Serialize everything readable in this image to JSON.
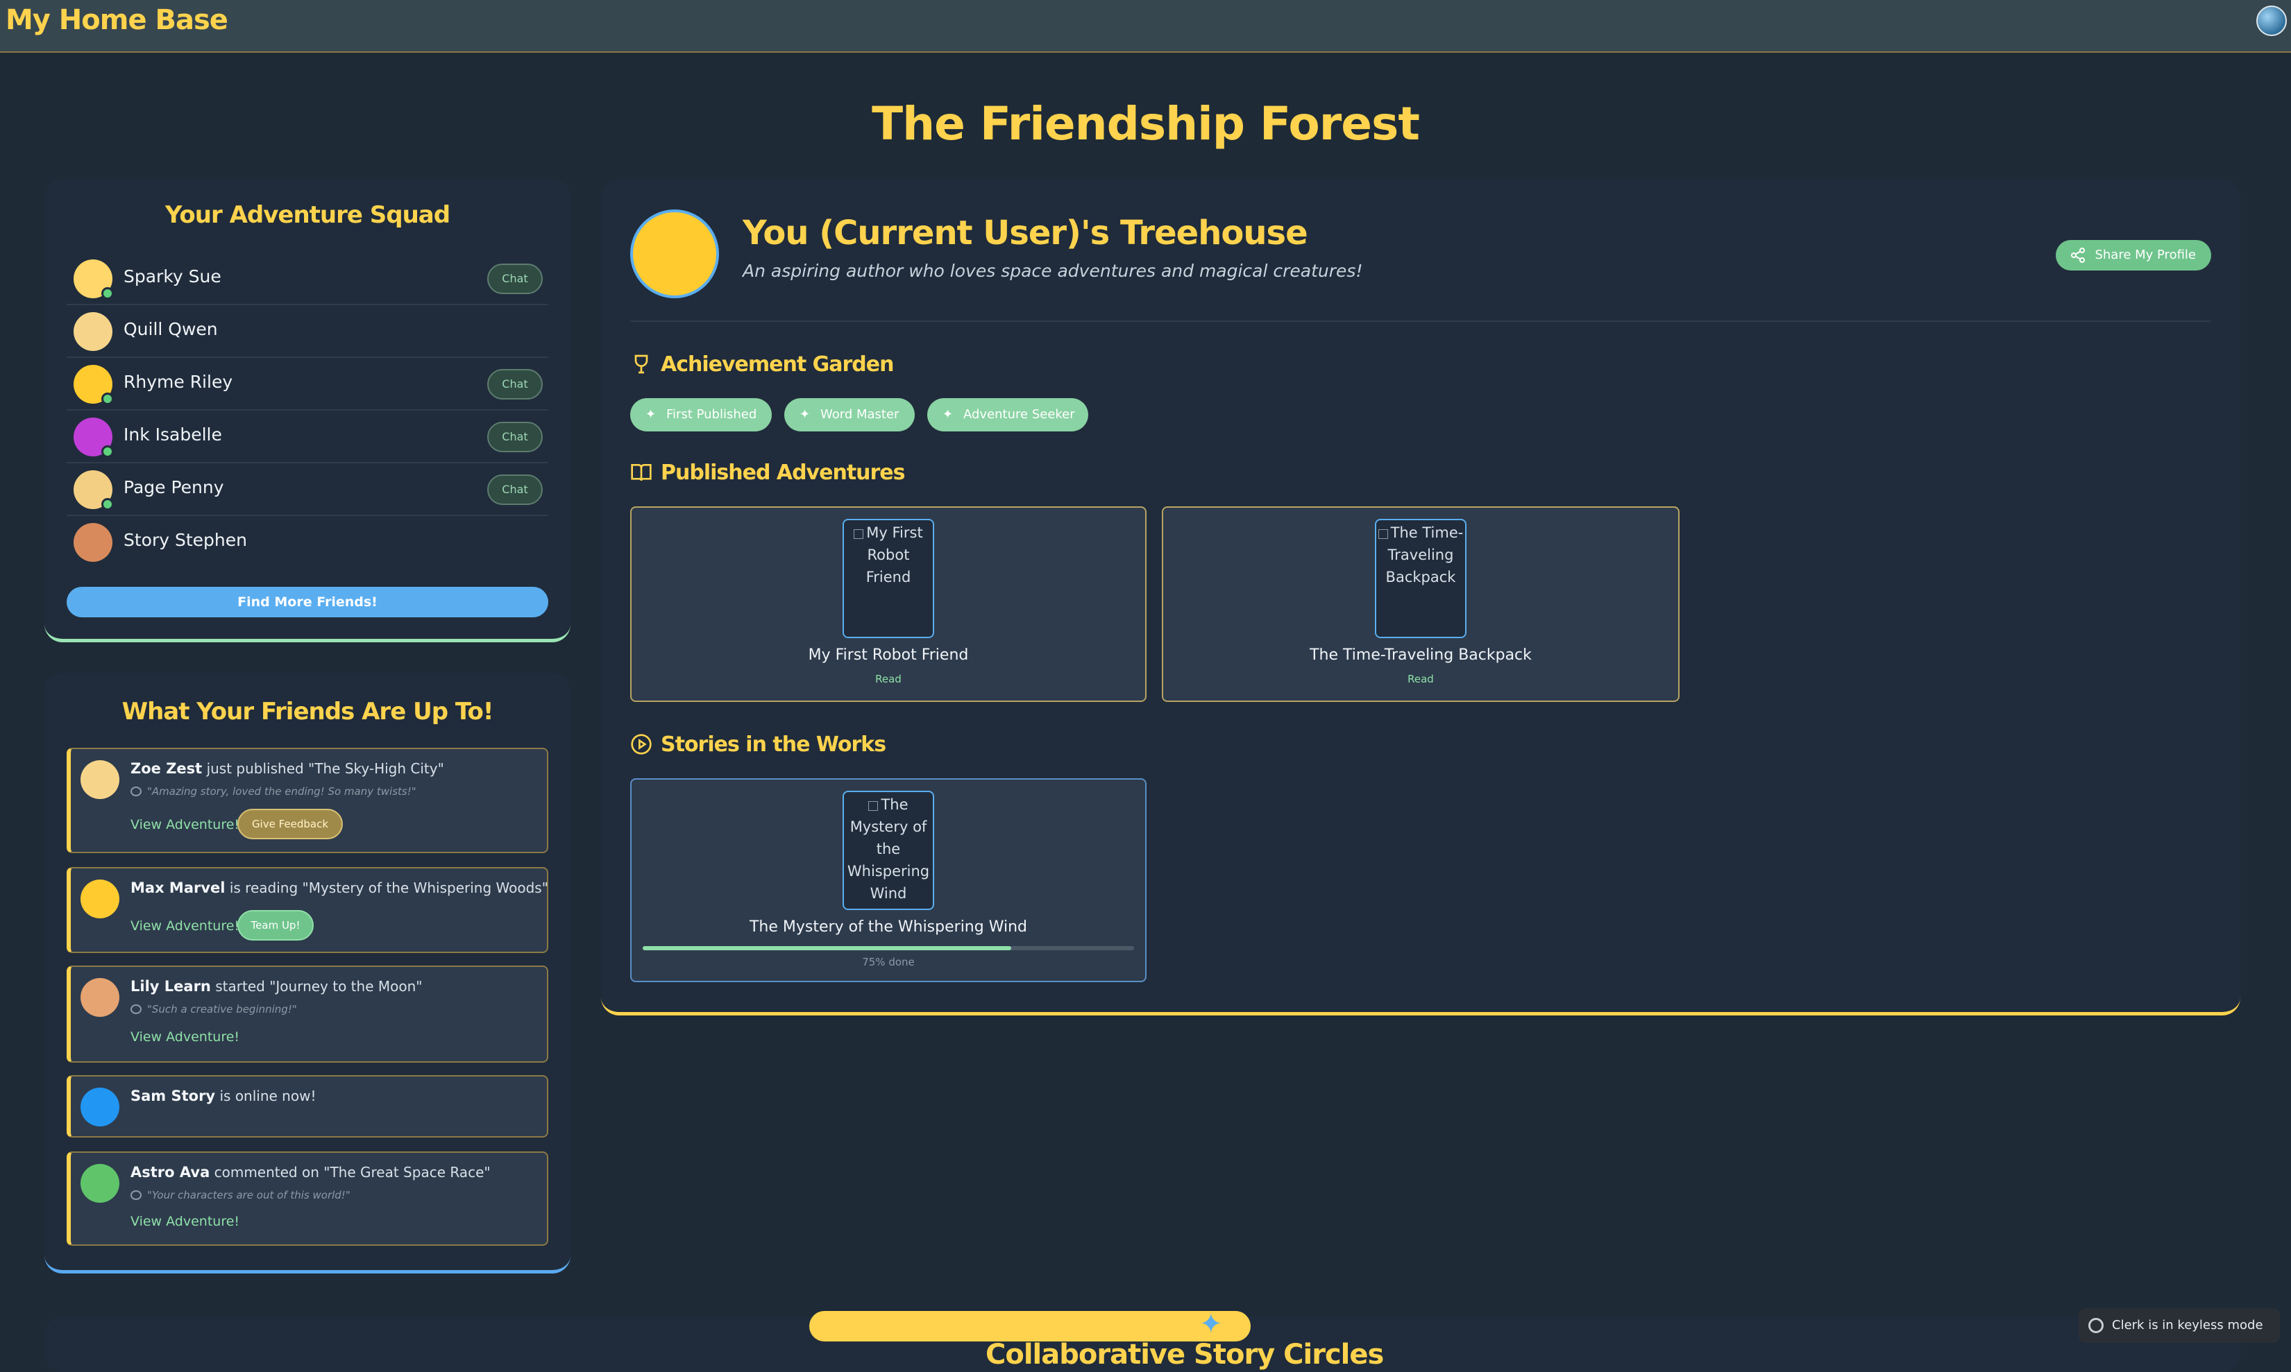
{
  "header": {
    "brand": "My Home Base"
  },
  "page_title": "The Friendship Forest",
  "squad": {
    "title": "Your Adventure Squad",
    "members": [
      {
        "name": "Sparky Sue",
        "emoji": "😜",
        "chat": "Chat",
        "online": true
      },
      {
        "name": "Quill Qwen",
        "emoji": "😁",
        "chat": "",
        "online": false
      },
      {
        "name": "Rhyme Riley",
        "emoji": "😛",
        "chat": "Chat",
        "online": true
      },
      {
        "name": "Ink Isabelle",
        "emoji": "🤪",
        "chat": "Chat",
        "online": true
      },
      {
        "name": "Page Penny",
        "emoji": "🙂",
        "chat": "Chat",
        "online": true
      },
      {
        "name": "Story Stephen",
        "emoji": "😞",
        "chat": "",
        "online": false
      }
    ],
    "find_button": "Find More Friends!"
  },
  "feed": {
    "title": "What Your Friends Are Up To!",
    "items": [
      {
        "who": "Zoe Zest",
        "action": " just published \"The Sky-High City\"",
        "quote": "\"Amazing story, loved the ending! So many twists!\"",
        "link": "View Adventure!",
        "button": "Give Feedback",
        "emoji": "😌"
      },
      {
        "who": "Max Marvel",
        "action": " is reading \"Mystery of the Whispering Woods\"",
        "quote": "",
        "link": "View Adventure!",
        "button": "Team Up!",
        "emoji": "😍"
      },
      {
        "who": "Lily Learn",
        "action": " started \"Journey to the Moon\"",
        "quote": "\"Such a creative beginning!\"",
        "link": "View Adventure!",
        "button": "",
        "emoji": "🤓"
      },
      {
        "who": "Sam Story",
        "action": " is online now!",
        "quote": "",
        "link": "",
        "button": "",
        "emoji": "😟"
      },
      {
        "who": "Astro Ava",
        "action": " commented on \"The Great Space Race\"",
        "quote": "\"Your characters are out of this world!\"",
        "link": "View Adventure!",
        "button": "",
        "emoji": "🤢"
      }
    ]
  },
  "profile": {
    "name": "You (Current User)'s Treehouse",
    "bio": "An aspiring author who loves space adventures and magical creatures!",
    "emoji": "😚",
    "share_button": "Share My Profile"
  },
  "achievements": {
    "title": "Achievement Garden",
    "badges": [
      "First Published",
      "Word Master",
      "Adventure Seeker"
    ]
  },
  "published": {
    "title": "Published Adventures",
    "stories": [
      {
        "cover_alt": "My First Robot Friend",
        "title": "My First Robot Friend",
        "action": "Read"
      },
      {
        "cover_alt": "The Time-Traveling Backpack",
        "title": "The Time-Traveling Backpack",
        "action": "Read"
      }
    ]
  },
  "works": {
    "title": "Stories in the Works",
    "stories": [
      {
        "cover_alt": "The Mystery of the Whispering Wind",
        "title": "The Mystery of the Whispering Wind",
        "progress": 0.75,
        "progress_label": "75% done"
      }
    ]
  },
  "bottom": {
    "title": "Collaborative Story Circles"
  },
  "clerk_notice": "Clerk is in keyless mode",
  "colors": {
    "accent": "#ffd34d",
    "green": "#8fe0a8",
    "blue": "#5aaef0",
    "panel": "#202c3b",
    "bg": "#1e2a36"
  }
}
